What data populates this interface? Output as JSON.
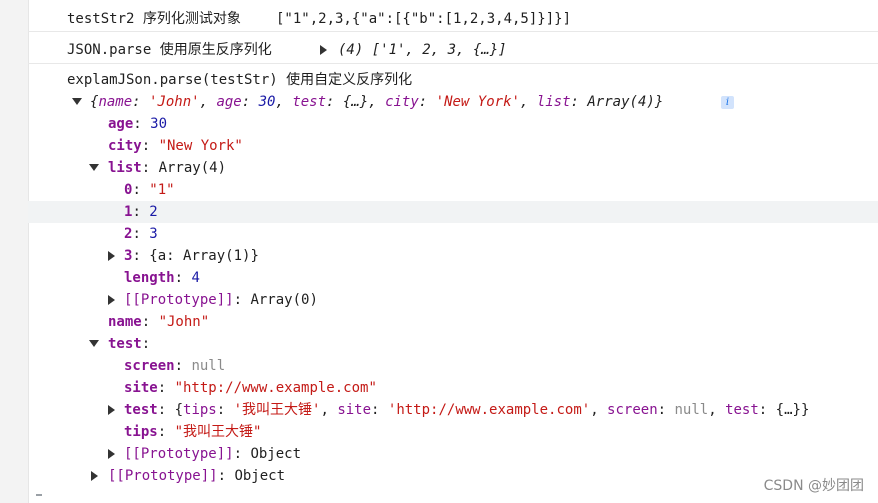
{
  "console": {
    "msg1": {
      "label": "testStr2 序列化测试对象",
      "value": "[\"1\",2,3,{\"a\":[{\"b\":[1,2,3,4,5]}]}]"
    },
    "msg2": {
      "label": "JSON.parse 使用原生反序列化",
      "preview": "(4) ['1', 2, 3, {…}]"
    },
    "msg3": {
      "label": "explamJSon.parse(testStr)  使用自定义反序列化"
    },
    "root": {
      "preview_open": "{",
      "preview_close": "}",
      "p": [
        {
          "k": "name",
          "v": "'John'"
        },
        {
          "k": "age",
          "v": "30"
        },
        {
          "k": "test",
          "v": "{…}"
        },
        {
          "k": "city",
          "v": "'New York'"
        },
        {
          "k": "list",
          "v": "Array(4)"
        }
      ],
      "info_icon": "i"
    },
    "tree": {
      "age": {
        "key": "age",
        "val": "30"
      },
      "city": {
        "key": "city",
        "val": "\"New York\""
      },
      "list": {
        "key": "list",
        "val": "Array(4)"
      },
      "list_0": {
        "key": "0",
        "val": "\"1\""
      },
      "list_1": {
        "key": "1",
        "val": "2"
      },
      "list_2": {
        "key": "2",
        "val": "3"
      },
      "list_3": {
        "key": "3",
        "val": "{a: Array(1)}"
      },
      "list_length": {
        "key": "length",
        "val": "4"
      },
      "list_proto": {
        "key": "[[Prototype]]",
        "val": "Array(0)"
      },
      "name": {
        "key": "name",
        "val": "\"John\""
      },
      "test": {
        "key": "test"
      },
      "test_screen": {
        "key": "screen",
        "val": "null"
      },
      "test_site": {
        "key": "site",
        "val": "\"http://www.example.com\""
      },
      "test_test": {
        "key": "test",
        "p": [
          {
            "k": "tips",
            "v": "'我叫王大锤'"
          },
          {
            "k": "site",
            "v": "'http://www.example.com'"
          },
          {
            "k": "screen",
            "v": "null"
          },
          {
            "k": "test",
            "v": "{…}"
          }
        ]
      },
      "test_tips": {
        "key": "tips",
        "val": "\"我叫王大锤\""
      },
      "test_proto": {
        "key": "[[Prototype]]",
        "val": "Object"
      },
      "root_proto": {
        "key": "[[Prototype]]",
        "val": "Object"
      }
    }
  },
  "watermark": "CSDN @妙团团"
}
